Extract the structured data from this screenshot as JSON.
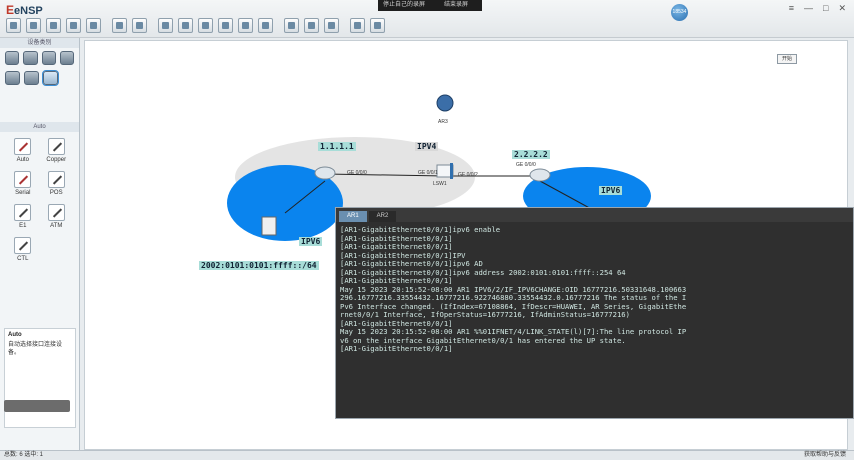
{
  "app": {
    "title": "eNSP",
    "overlay_buttons": [
      "停止自己的录屏",
      "结束录屏"
    ],
    "user_badge": "18534"
  },
  "left_panel": {
    "devices_title": "设备类别",
    "auto_section_title": "Auto",
    "connectors": [
      "Auto",
      "Copper",
      "Serial",
      "POS",
      "E1",
      "ATM",
      "CTL"
    ],
    "description_title": "Auto",
    "description_text": "自动选择接口连接设备。"
  },
  "canvas": {
    "top_button": "开始",
    "devices": {
      "ar3": "AR3",
      "lsw": "LSW1"
    },
    "labels": {
      "ipv4_router": "1.1.1.1",
      "ipv4_router2": "2.2.2.2",
      "ipv4_zone": "IPV4",
      "ipv6_left": "IPV6",
      "ipv6_right": "IPV6",
      "ipv6_prefix": "2002:0101:0101:ffff::/64"
    },
    "ports": {
      "p1": "GE 0/0/0",
      "p2": "GE 0/0/1",
      "p3": "GE 0/0/2",
      "p4": "GE 0/0/0"
    }
  },
  "terminal": {
    "tabs": [
      "AR1",
      "AR2"
    ],
    "lines": [
      "[AR1-GigabitEthernet0/0/1]ipv6 enable",
      "[AR1-GigabitEthernet0/0/1]",
      "[AR1-GigabitEthernet0/0/1]",
      "[AR1-GigabitEthernet0/0/1]IPV",
      "[AR1-GigabitEthernet0/0/1]ipv6 AD",
      "[AR1-GigabitEthernet0/0/1]ipv6 address 2002:0101:0101:ffff::254 64",
      "[AR1-GigabitEthernet0/0/1]",
      "May 15 2023 20:15:52-08:00 AR1 IPV6/2/IF_IPV6CHANGE:OID 16777216.50331648.100663",
      "296.16777216.33554432.16777216.922746880.33554432.0.16777216 The status of the I",
      "Pv6 Interface changed. (IfIndex=67108864, IfDescr=HUAWEI, AR Series, GigabitEthe",
      "rnet0/0/1 Interface, IfOperStatus=16777216, IfAdminStatus=16777216)",
      "[AR1-GigabitEthernet0/0/1]",
      "May 15 2023 20:15:52-08:00 AR1 %%01IFNET/4/LINK_STATE(l)[7]:The line protocol IP",
      "v6 on the interface GigabitEthernet0/0/1 has entered the UP state.",
      "[AR1-GigabitEthernet0/0/1]"
    ]
  },
  "status": {
    "left": "总数: 6 选中: 1",
    "right": "获取帮助与反馈"
  }
}
